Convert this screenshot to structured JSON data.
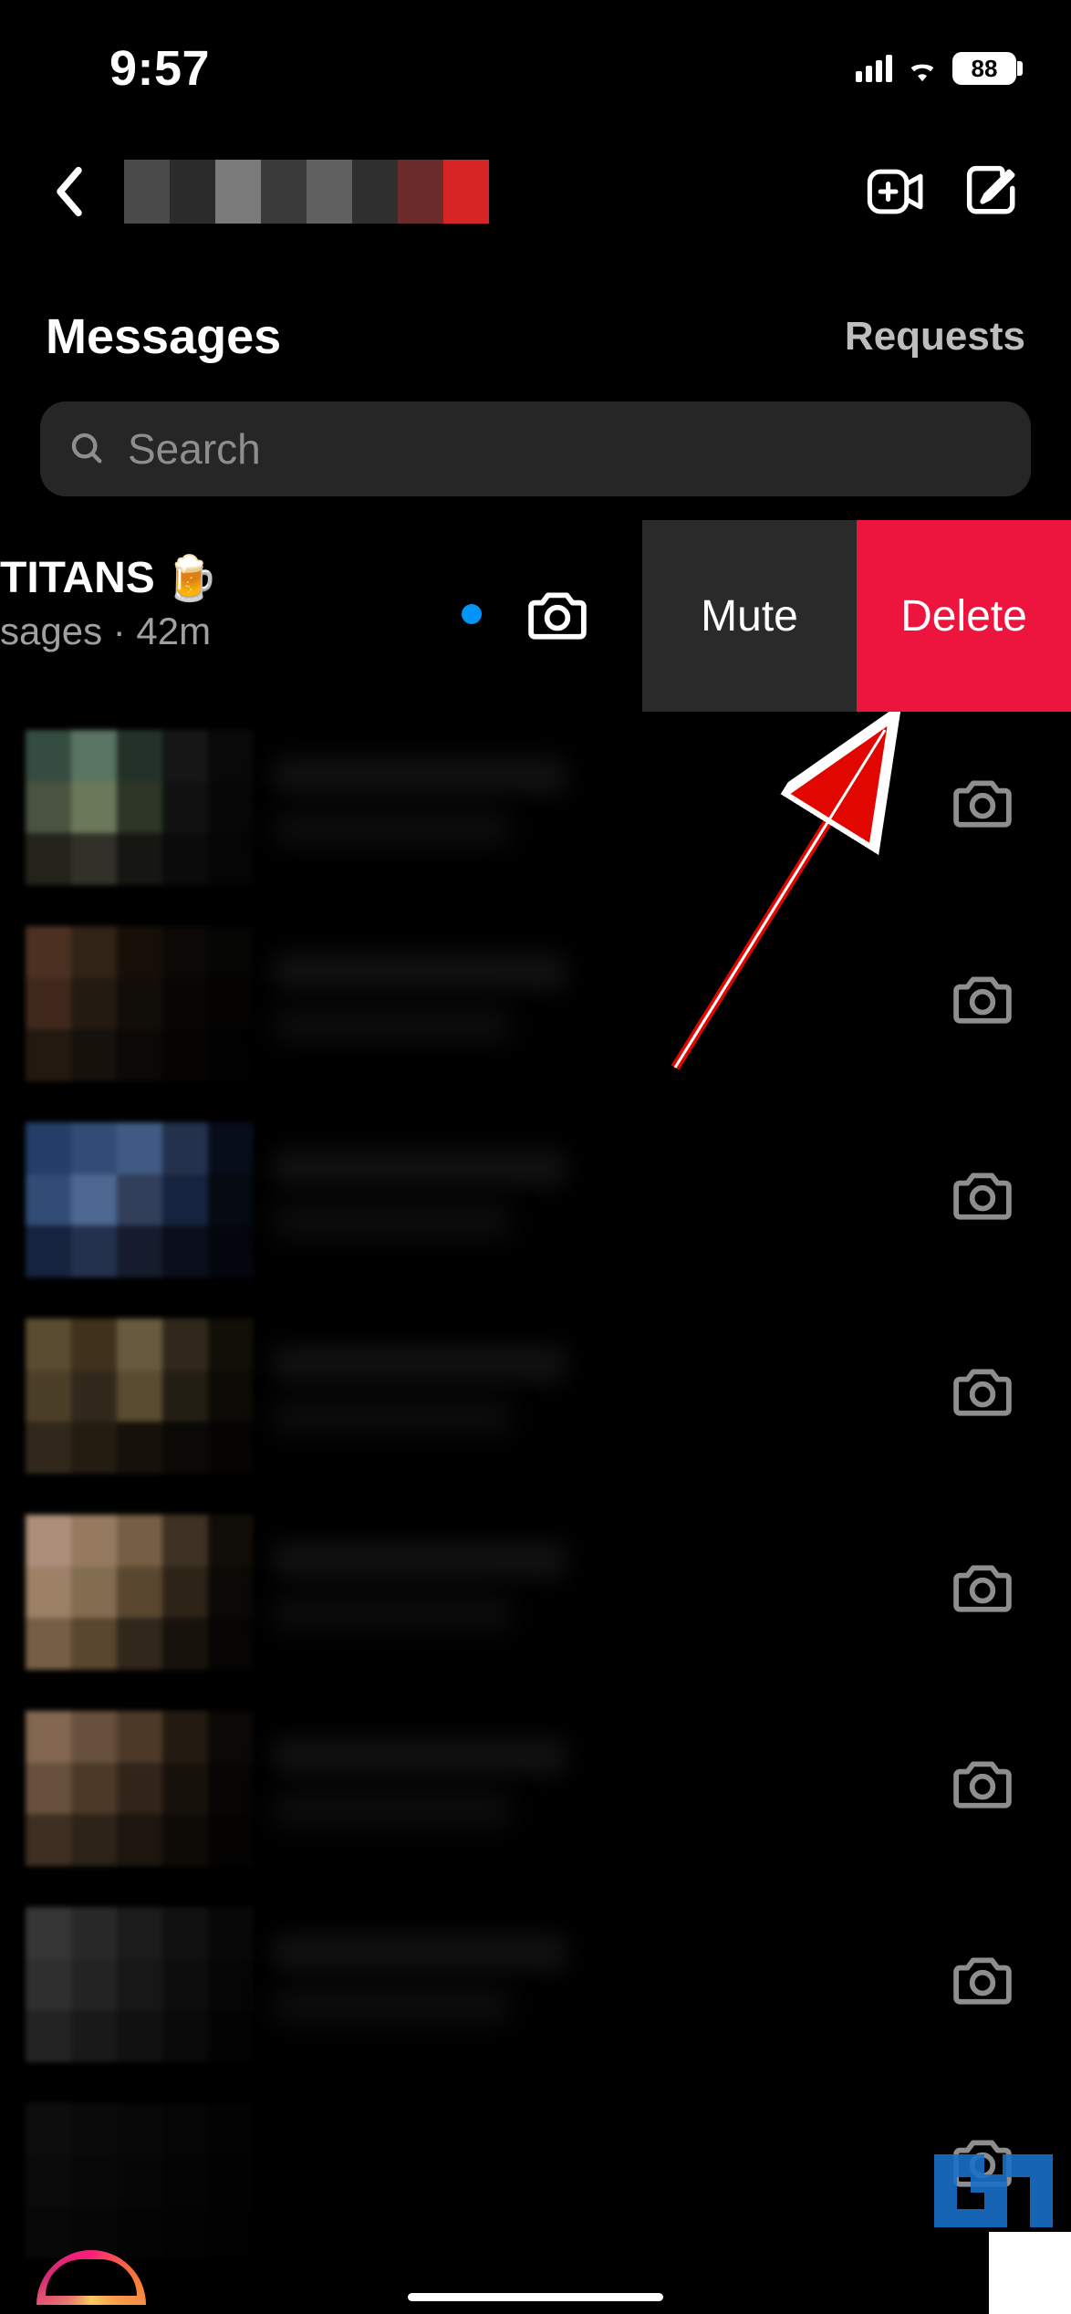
{
  "status_bar": {
    "time": "9:57",
    "battery": "88"
  },
  "nav": {
    "back_aria": "Back"
  },
  "section": {
    "title": "Messages",
    "requests": "Requests"
  },
  "search": {
    "placeholder": "Search"
  },
  "swiped_chat": {
    "title": "TITANS",
    "title_emoji": "🍺",
    "subtitle_prefix": "sages",
    "time_sep": " · ",
    "time": "42m"
  },
  "swipe_actions": {
    "mute": "Mute",
    "delete": "Delete"
  },
  "watermark": "G"
}
